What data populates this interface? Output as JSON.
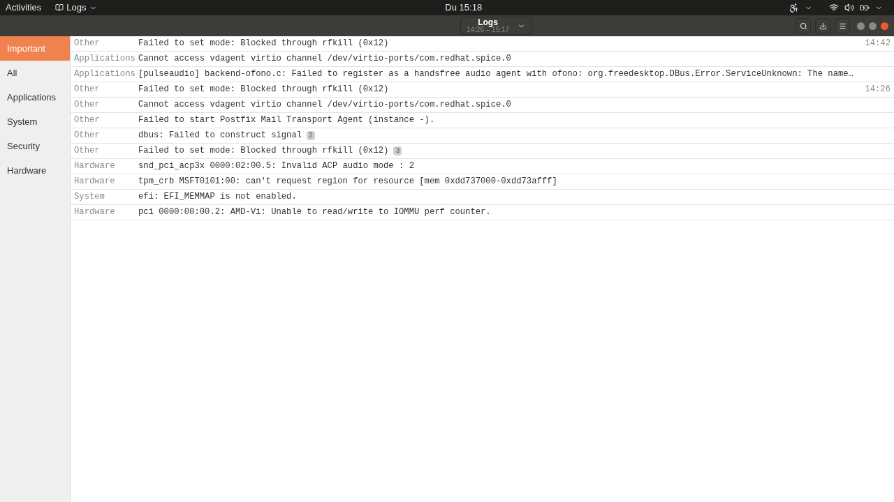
{
  "top_bar": {
    "activities": "Activities",
    "app_menu": "Logs",
    "clock": "Du 15:18"
  },
  "header": {
    "title": "Logs",
    "subtitle": "14:26 – 15:17"
  },
  "sidebar": {
    "items": [
      {
        "label": "Important",
        "selected": true
      },
      {
        "label": "All",
        "selected": false
      },
      {
        "label": "Applications",
        "selected": false
      },
      {
        "label": "System",
        "selected": false
      },
      {
        "label": "Security",
        "selected": false
      },
      {
        "label": "Hardware",
        "selected": false
      }
    ]
  },
  "events": [
    {
      "category": "Other",
      "message": "Failed to set mode: Blocked through rfkill (0x12)",
      "time": "14:42"
    },
    {
      "category": "Applications",
      "message": "Cannot access vdagent virtio channel /dev/virtio-ports/com.redhat.spice.0"
    },
    {
      "category": "Applications",
      "message": "[pulseaudio] backend-ofono.c: Failed to register as a handsfree audio agent with ofono: org.freedesktop.DBus.Error.ServiceUnknown: The name…"
    },
    {
      "category": "Other",
      "message": "Failed to set mode: Blocked through rfkill (0x12)",
      "time": "14:26"
    },
    {
      "category": "Other",
      "message": "Cannot access vdagent virtio channel /dev/virtio-ports/com.redhat.spice.0"
    },
    {
      "category": "Other",
      "message": "Failed to start Postfix Mail Transport Agent (instance -)."
    },
    {
      "category": "Other",
      "message": "dbus: Failed to construct signal",
      "count": "2"
    },
    {
      "category": "Other",
      "message": "Failed to set mode: Blocked through rfkill (0x12)",
      "count": "3"
    },
    {
      "category": "Hardware",
      "message": "snd_pci_acp3x 0000:02:00.5: Invalid ACP audio mode : 2"
    },
    {
      "category": "Hardware",
      "message": "tpm_crb MSFT0101:00: can't request region for resource [mem 0xdd737000-0xdd73afff]"
    },
    {
      "category": "System",
      "message": "efi: EFI_MEMMAP is not enabled."
    },
    {
      "category": "Hardware",
      "message": "pci 0000:00:00.2: AMD-Vi: Unable to read/write to IOMMU perf counter."
    }
  ]
}
